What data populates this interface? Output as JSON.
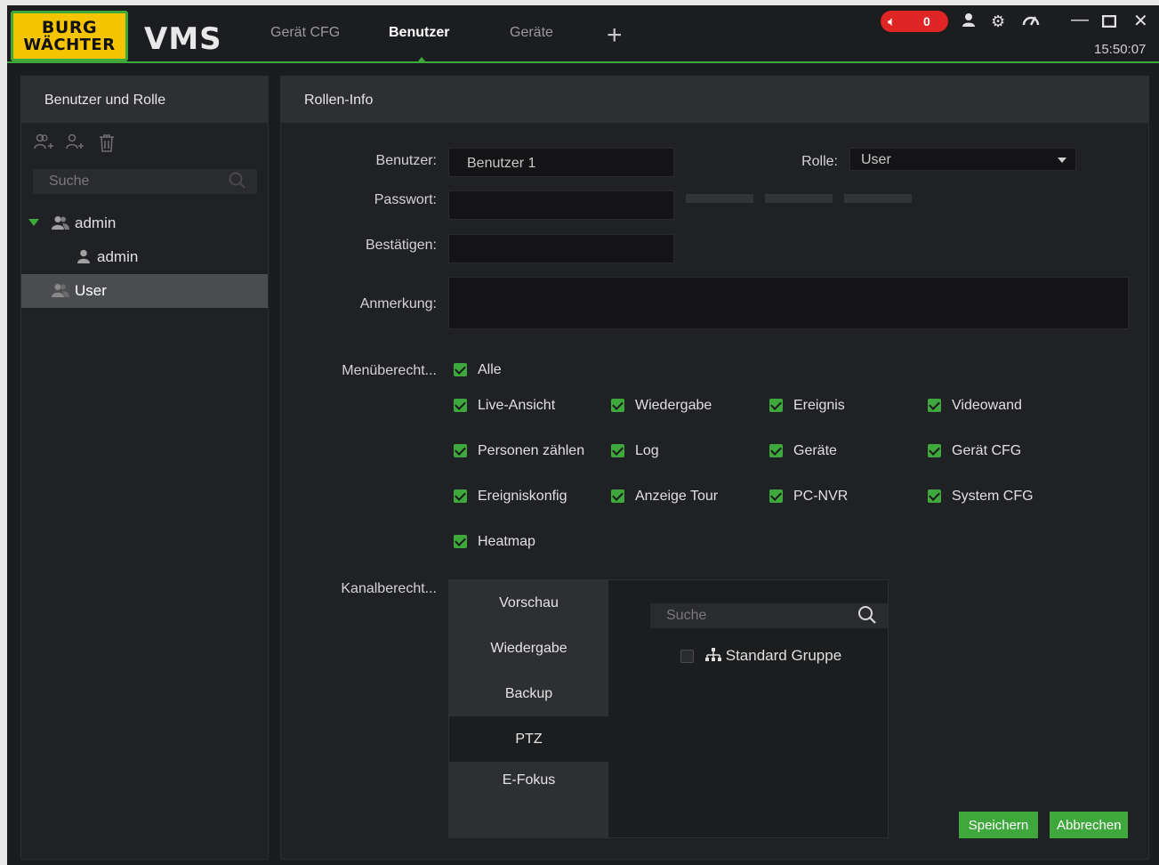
{
  "app": {
    "brand_line1": "BURG",
    "brand_line2": "WÄCHTER",
    "name": "VMS",
    "tabs": [
      "Gerät CFG",
      "Benutzer",
      "Geräte"
    ],
    "active_tab": "Benutzer",
    "alarm_count": "0",
    "time": "15:50:07",
    "accent_color": "#3ea83c",
    "alarm_color": "#e02525"
  },
  "left_panel": {
    "title": "Benutzer und Rolle",
    "search_placeholder": "Suche",
    "tree": {
      "group_admin": "admin",
      "user_admin": "admin",
      "group_user": "User"
    }
  },
  "right_panel": {
    "title": "Rollen-Info",
    "labels": {
      "user": "Benutzer:",
      "role": "Rolle:",
      "password": "Passwort:",
      "confirm": "Bestätigen:",
      "remark": "Anmerkung:",
      "menu_rights": "Menüberecht...",
      "channel_rights": "Kanalberecht..."
    },
    "user_value": "Benutzer 1",
    "role_value": "User",
    "menu_permissions": {
      "all": "Alle",
      "items": [
        "Live-Ansicht",
        "Wiedergabe",
        "Ereignis",
        "Videowand",
        "Personen zählen",
        "Log",
        "Geräte",
        "Gerät CFG",
        "Ereigniskonfig",
        "Anzeige Tour",
        "PC-NVR",
        "System CFG",
        "Heatmap"
      ]
    },
    "channel": {
      "tabs": [
        "Vorschau",
        "Wiedergabe",
        "Backup",
        "PTZ",
        "E-Fokus"
      ],
      "selected_tab": "PTZ",
      "search_placeholder": "Suche",
      "group": "Standard Gruppe"
    },
    "buttons": {
      "save": "Speichern",
      "cancel": "Abbrechen"
    }
  }
}
